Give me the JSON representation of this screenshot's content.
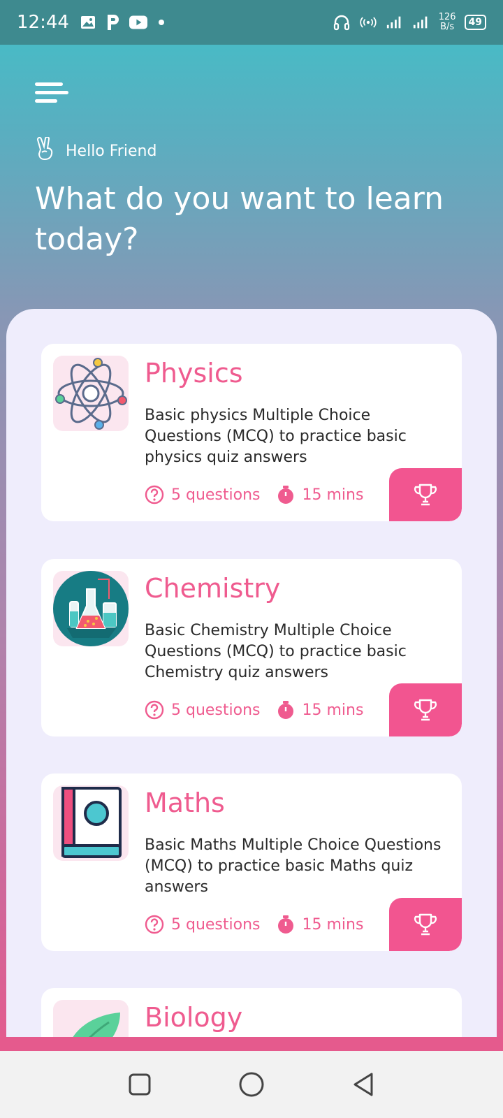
{
  "status_bar": {
    "time": "12:44",
    "speed_value": "126",
    "speed_unit": "B/s",
    "battery": "49"
  },
  "greeting": {
    "text": "Hello Friend"
  },
  "headline": "What do you want to learn today?",
  "courses": [
    {
      "title": "Physics",
      "description": "Basic physics Multiple Choice Questions (MCQ) to practice basic physics quiz answers",
      "questions": "5 questions",
      "duration": "15 mins"
    },
    {
      "title": "Chemistry",
      "description": "Basic Chemistry Multiple Choice Questions (MCQ) to practice basic Chemistry quiz answers",
      "questions": "5 questions",
      "duration": "15 mins"
    },
    {
      "title": "Maths",
      "description": "Basic Maths Multiple Choice Questions (MCQ) to practice basic Maths quiz answers",
      "questions": "5 questions",
      "duration": "15 mins"
    },
    {
      "title": "Biology"
    }
  ],
  "colors": {
    "accent": "#ef5b8f",
    "button": "#f25590",
    "panel": "#efedfc",
    "status_bar": "#3e8a8f"
  },
  "icons": {
    "menu": "menu-icon",
    "greeting": "peace-hand-icon",
    "questions": "question-circle-icon",
    "duration": "stopwatch-icon",
    "action": "trophy-icon"
  }
}
